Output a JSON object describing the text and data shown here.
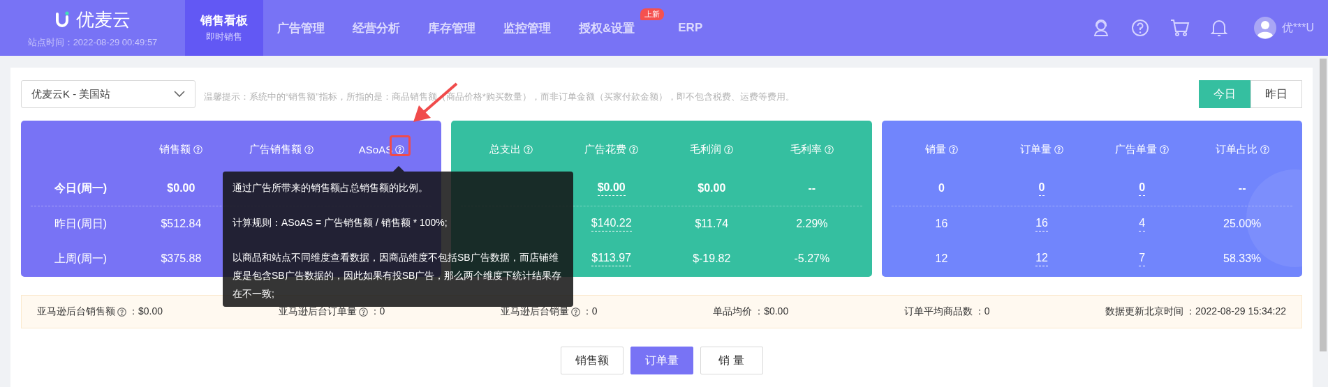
{
  "nav": {
    "logo": "优麦云",
    "site_time": "站点时间：2022-08-29 00:49:57",
    "tabs": [
      {
        "label": "销售看板",
        "sub": "即时销售",
        "selected": true
      },
      {
        "label": "广告管理",
        "selected": false
      },
      {
        "label": "经营分析",
        "selected": false
      },
      {
        "label": "库存管理",
        "selected": false
      },
      {
        "label": "监控管理",
        "selected": false
      },
      {
        "label": "授权&设置",
        "badge": "上新",
        "selected": false
      },
      {
        "label": "ERP",
        "selected": false
      }
    ],
    "user": "优***U"
  },
  "store_select": "优麦云K - 美国站",
  "notice": "温馨提示：系统中的“销售额”指标，所指的是：商品销售额（商品价格*购买数量），而非订单金额（买家付款金额），即不包含税费、运费等费用。",
  "day_toggle": [
    {
      "label": "今日",
      "selected": true
    },
    {
      "label": "昨日",
      "selected": false
    }
  ],
  "panels": [
    {
      "color": "#7873f5",
      "row_labels": [
        "今日(周一)",
        "昨日(周日)",
        "上周(周一)"
      ],
      "columns": [
        {
          "header": "销售额",
          "values": [
            "$0.00",
            "$512.84",
            "$375.88"
          ]
        },
        {
          "header": "广告销售额"
        },
        {
          "header": "ASoAS"
        }
      ]
    },
    {
      "color": "#35bfa0",
      "columns": [
        {
          "header": "总支出"
        },
        {
          "header": "广告花费",
          "underlined": true,
          "values": [
            "$0.00",
            "$140.22",
            "$113.97"
          ]
        },
        {
          "header": "毛利润",
          "values": [
            "$0.00",
            "$11.74",
            "$-19.82"
          ]
        },
        {
          "header": "毛利率",
          "values": [
            "--",
            "2.29%",
            "-5.27%"
          ]
        }
      ]
    },
    {
      "color": "#7185fc",
      "columns": [
        {
          "header": "销量",
          "values": [
            "0",
            "16",
            "12"
          ]
        },
        {
          "header": "订单量",
          "underlined": true,
          "values": [
            "0",
            "16",
            "12"
          ]
        },
        {
          "header": "广告单量",
          "underlined": true,
          "values": [
            "0",
            "4",
            "7"
          ]
        },
        {
          "header": "订单占比",
          "values": [
            "--",
            "25.00%",
            "58.33%"
          ]
        }
      ]
    }
  ],
  "tooltip": [
    "通过广告所带来的销售额占总销售额的比例。",
    "计算规则：ASoAS = 广告销售额 / 销售额 * 100%;",
    "以商品和站点不同维度查看数据，因商品维度不包括SB广告数据，而店铺维度是包含SB广告数据的，因此如果有投SB广告，那么两个维度下统计结果存在不一致;"
  ],
  "summary": [
    {
      "label": "亚马逊后台销售额",
      "help": true,
      "value": "：$0.00"
    },
    {
      "label": "亚马逊后台订单量",
      "help": true,
      "value": "：0"
    },
    {
      "label": "亚马逊后台销量",
      "help": true,
      "value": "：0"
    },
    {
      "label": "单品均价",
      "help": false,
      "value": "：$0.00"
    },
    {
      "label": "订单平均商品数",
      "help": false,
      "value": "：0"
    },
    {
      "label": "数据更新北京时间",
      "help": false,
      "value": "：2022-08-29 15:34:22"
    }
  ],
  "metric_buttons": [
    {
      "label": "销售额",
      "selected": false
    },
    {
      "label": "订单量",
      "selected": true
    },
    {
      "label": "销 量",
      "selected": false
    }
  ]
}
